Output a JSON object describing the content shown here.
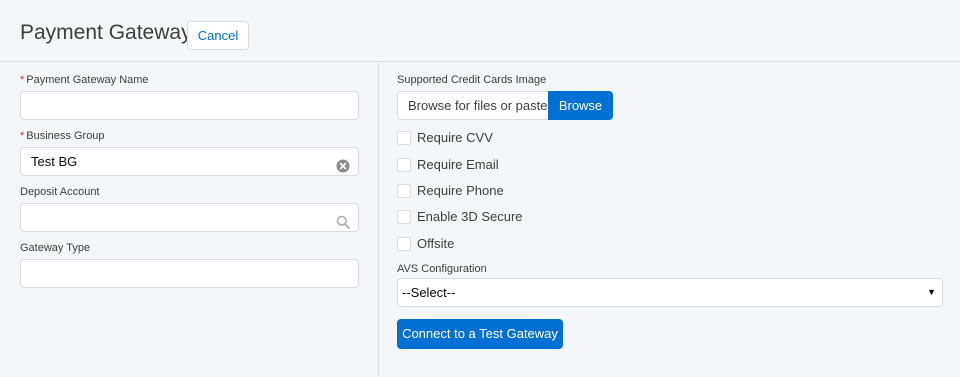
{
  "header": {
    "title": "Payment Gateway",
    "cancel_label": "Cancel"
  },
  "left": {
    "fields": [
      {
        "label": "Payment Gateway Name",
        "required": "*",
        "value": ""
      },
      {
        "label": "Business Group",
        "required": "*",
        "value": "Test BG",
        "icon": "clear-icon"
      },
      {
        "label": "Deposit Account",
        "value": "",
        "icon": "search-icon"
      },
      {
        "label": "Gateway Type",
        "value": ""
      }
    ]
  },
  "right": {
    "image_label": "Supported Credit Cards Image",
    "browse_placeholder": "Browse for files or paste",
    "browse_button": "Browse",
    "checkboxes": [
      {
        "label": "Require CVV",
        "checked": false
      },
      {
        "label": "Require Email",
        "checked": false
      },
      {
        "label": "Require Phone",
        "checked": false
      },
      {
        "label": "Enable 3D Secure",
        "checked": false
      },
      {
        "label": "Offsite",
        "checked": false
      }
    ],
    "avs_label": "AVS Configuration",
    "avs_value": "--Select--",
    "connect_button": "Connect to a Test Gateway"
  },
  "colors": {
    "brand": "#0070d2",
    "required": "#c23934",
    "background": "#f4f6f9",
    "border": "#dddbda"
  }
}
